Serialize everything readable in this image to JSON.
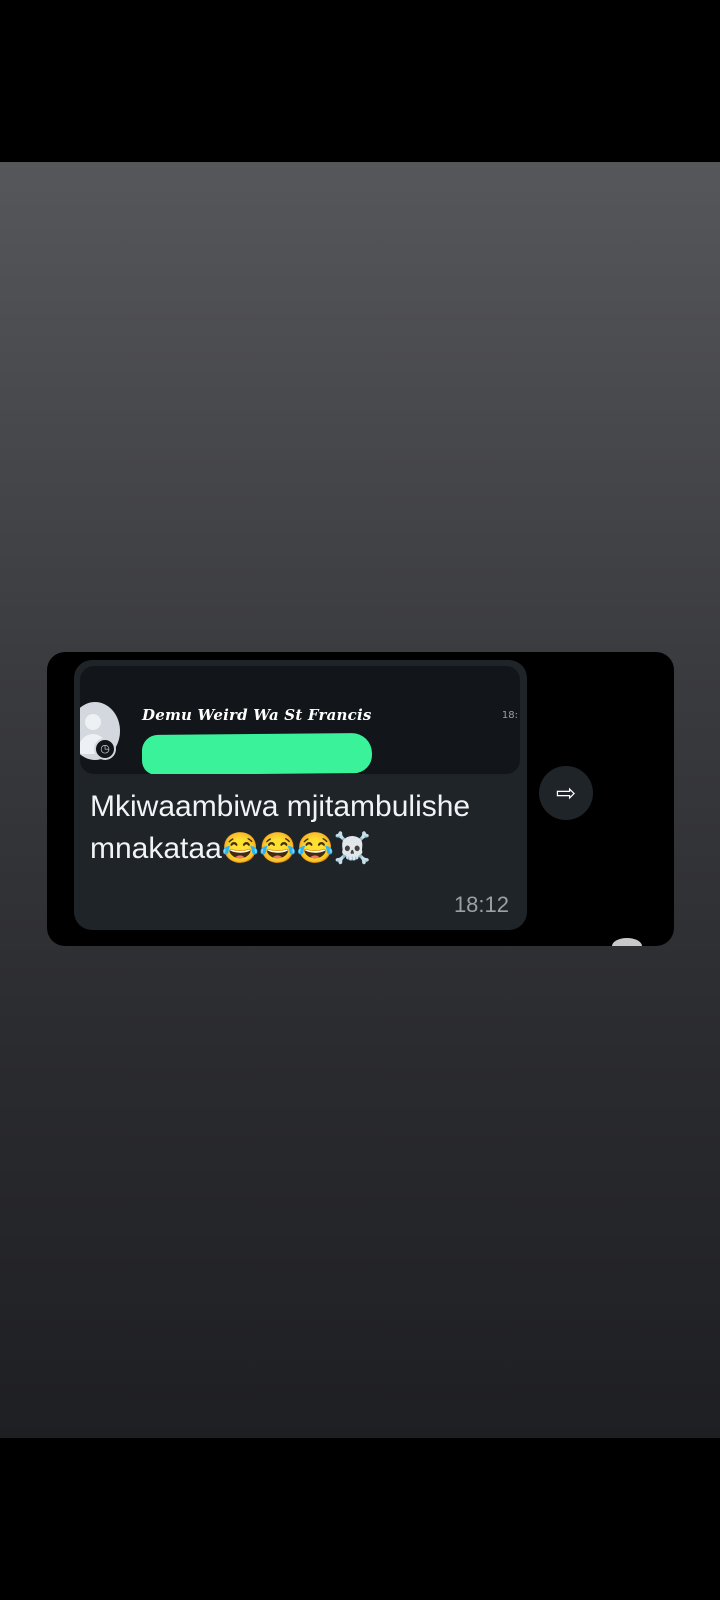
{
  "quoted_message": {
    "sender_name": "Demu Weird Wa St Francis",
    "time_partial": "18:"
  },
  "message": {
    "text": "Mkiwaambiwa mjitambulishe mnakataa😂😂😂☠️",
    "time": "18:12"
  },
  "icons": {
    "forward": "forward-icon",
    "avatar": "default-avatar-icon",
    "timer": "disappearing-timer-icon"
  },
  "colors": {
    "bubble": "#1f2428",
    "quote": "#121519",
    "redaction": "#3af29a"
  }
}
